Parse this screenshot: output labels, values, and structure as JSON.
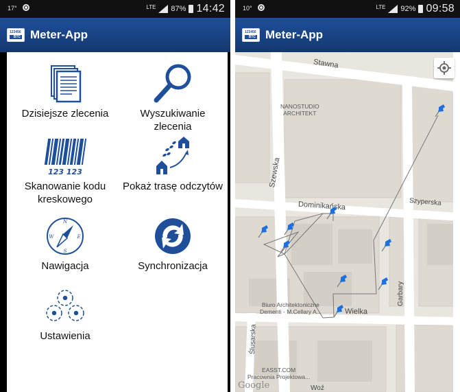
{
  "left_phone": {
    "status": {
      "left_text": "17°",
      "lte": "LTE",
      "battery": "87%",
      "time": "14:42"
    },
    "app_title": "Meter-App",
    "menu": [
      {
        "id": "today-orders",
        "label": "Dzisiejsze zlecenia",
        "icon": "documents-icon"
      },
      {
        "id": "search-order",
        "label": "Wyszukiwanie\nzlecenia",
        "icon": "magnifier-icon"
      },
      {
        "id": "barcode-scan",
        "label": "Skanowanie kodu\nkreskowego",
        "icon": "barcode-icon"
      },
      {
        "id": "reading-route",
        "label": "Pokaż trasę odczytów",
        "icon": "route-icon"
      },
      {
        "id": "navigation",
        "label": "Nawigacja",
        "icon": "compass-icon"
      },
      {
        "id": "sync",
        "label": "Synchronizacja",
        "icon": "sync-icon"
      },
      {
        "id": "settings",
        "label": "Ustawienia",
        "icon": "gears-icon"
      }
    ],
    "barcode_digits": "123 123",
    "compass_letters": {
      "n": "N",
      "s": "S",
      "e": "E",
      "w": "W"
    }
  },
  "right_phone": {
    "status": {
      "left_text": "10°",
      "lte": "LTE",
      "battery": "92%",
      "time": "09:58"
    },
    "app_title": "Meter-App",
    "map": {
      "streets": {
        "stawna": "Stawna",
        "szewska": "Szewska",
        "dominikanska": "Dominikańska",
        "szyperska": "Szyperska",
        "garbary": "Garbary",
        "wielka": "Wielka",
        "slusarska": "Ślusarska",
        "bottom": "Woź"
      },
      "pois": {
        "nanostudio": "NANOSTUDIO\nARCHITEKT",
        "biuro": "Biuro Architektoniczne\nDementi - M.Cellary A...",
        "easst": "EASST.COM\nPracownia Projektowa..."
      },
      "attribution": "Google",
      "locate_icon": "crosshair-icon",
      "pin_color": "#1e6fe0"
    }
  },
  "colors": {
    "appbar": "#1f4f9b",
    "icon_blue": "#1f4f9b",
    "map_bg": "#e9e6df"
  }
}
